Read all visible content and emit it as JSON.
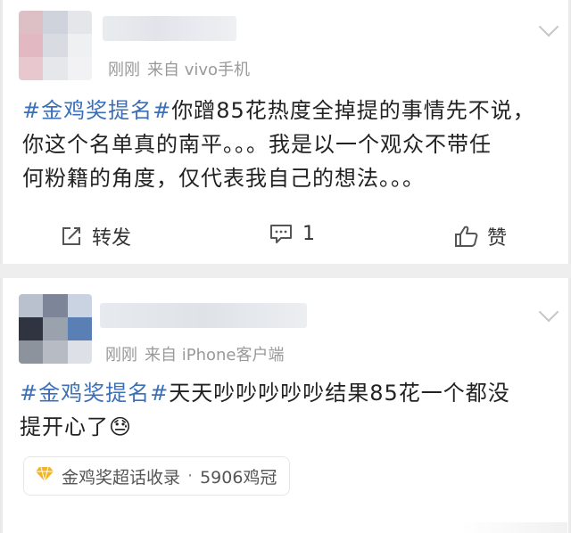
{
  "post1": {
    "meta_time": "刚刚",
    "meta_source": "来自 vivo手机",
    "body_topic": "#金鸡奖提名#",
    "body_line1_rest": "你蹭85花热度全掉提的事情先不说，",
    "body_line2": "你这个名单真的南平。。。我是以一个观众不带任",
    "body_line3": "何粉籍的角度，仅代表我自己的想法。。。",
    "forward_label": "转发",
    "comment_count": "1",
    "like_label": "赞"
  },
  "post2": {
    "meta_time": "刚刚",
    "meta_source": "来自 iPhone客户端",
    "body_topic": "#金鸡奖提名#",
    "body_line1_rest": "天天吵吵吵吵吵结果85花一个都没",
    "body_line2": "提开心了",
    "emoji": "😓",
    "supertopic_label": "金鸡奖超话收录",
    "supertopic_sep": "·",
    "supertopic_count": "5906鸡冠"
  },
  "colors": {
    "topic_blue": "#3b6fb6",
    "meta_gray": "#999999",
    "divider_gray": "#eeeeee",
    "supertopic_icon": "#f0b429"
  },
  "icons": {
    "forward": "share-edit-icon",
    "comment": "comment-bubble-icon",
    "like": "thumbs-up-icon",
    "menu": "chevron-down-icon",
    "supertopic": "diamond-icon"
  }
}
